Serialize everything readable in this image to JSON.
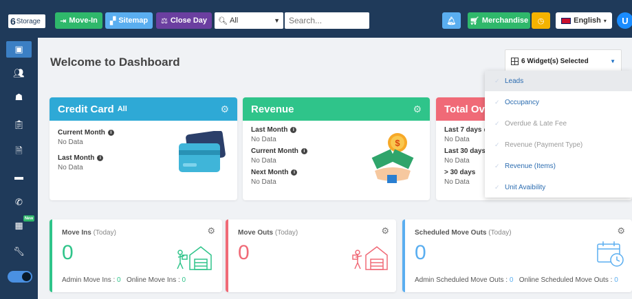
{
  "header": {
    "logo_text": "Storage",
    "logo_letter": "6",
    "move_in_label": "Move-In",
    "sitemap_label": "Sitemap",
    "close_day_label": "Close Day",
    "search_scope": "All",
    "search_placeholder": "Search...",
    "merchandise_label": "Merchandise",
    "language_label": "English",
    "avatar_initial": "U"
  },
  "sidebar": {
    "new_badge": "New",
    "items": [
      "dashboard-icon",
      "users-icon",
      "unit-icon",
      "clipboard-icon",
      "document-icon",
      "card-icon",
      "phone-icon",
      "calculator-icon",
      "tools-icon",
      "toggle"
    ]
  },
  "main": {
    "title": "Welcome to Dashboard",
    "widget_select_label": "6 Widget(s) Selected"
  },
  "credit_card": {
    "title": "Credit Card",
    "subtitle": "All",
    "current_month_label": "Current Month",
    "current_month_value": "No Data",
    "last_month_label": "Last Month",
    "last_month_value": "No Data"
  },
  "revenue": {
    "title": "Revenue",
    "last_month_label": "Last Month",
    "last_month_value": "No Data",
    "current_month_label": "Current Month",
    "current_month_value": "No Data",
    "next_month_label": "Next Month",
    "next_month_value": "No Data"
  },
  "total_overdue": {
    "title": "Total Ove",
    "last7_label": "Last 7 days",
    "last7_value": "No Data",
    "last30_label": "Last 30 days",
    "last30_value": "No Data",
    "gt30_label": "> 30 days",
    "gt30_value": "No Data"
  },
  "move_ins": {
    "title": "Move Ins",
    "period": "(Today)",
    "count": "0",
    "admin_label": "Admin Move Ins :",
    "admin_value": "0",
    "online_label": "Online Move Ins :",
    "online_value": "0"
  },
  "move_outs": {
    "title": "Move Outs",
    "period": "(Today)",
    "count": "0"
  },
  "scheduled_move_outs": {
    "title": "Scheduled Move Outs",
    "period": "(Today)",
    "count": "0",
    "admin_label": "Admin Scheduled Move Outs :",
    "admin_value": "0",
    "online_label": "Online Scheduled Move Outs :",
    "online_value": "0"
  },
  "widget_dropdown": {
    "items": [
      {
        "label": "Leads",
        "selected": true
      },
      {
        "label": "Occupancy",
        "selected": true
      },
      {
        "label": "Overdue & Late Fee",
        "selected": false
      },
      {
        "label": "Revenue (Payment Type)",
        "selected": false
      },
      {
        "label": "Revenue (Items)",
        "selected": true
      },
      {
        "label": "Unit Avaibility",
        "selected": true
      }
    ]
  },
  "colors": {
    "topbar": "#1f3a5a",
    "credit_card": "#2ea9d6",
    "revenue": "#2fc48a",
    "overdue": "#f06a77",
    "scheduled": "#5aaef0"
  }
}
